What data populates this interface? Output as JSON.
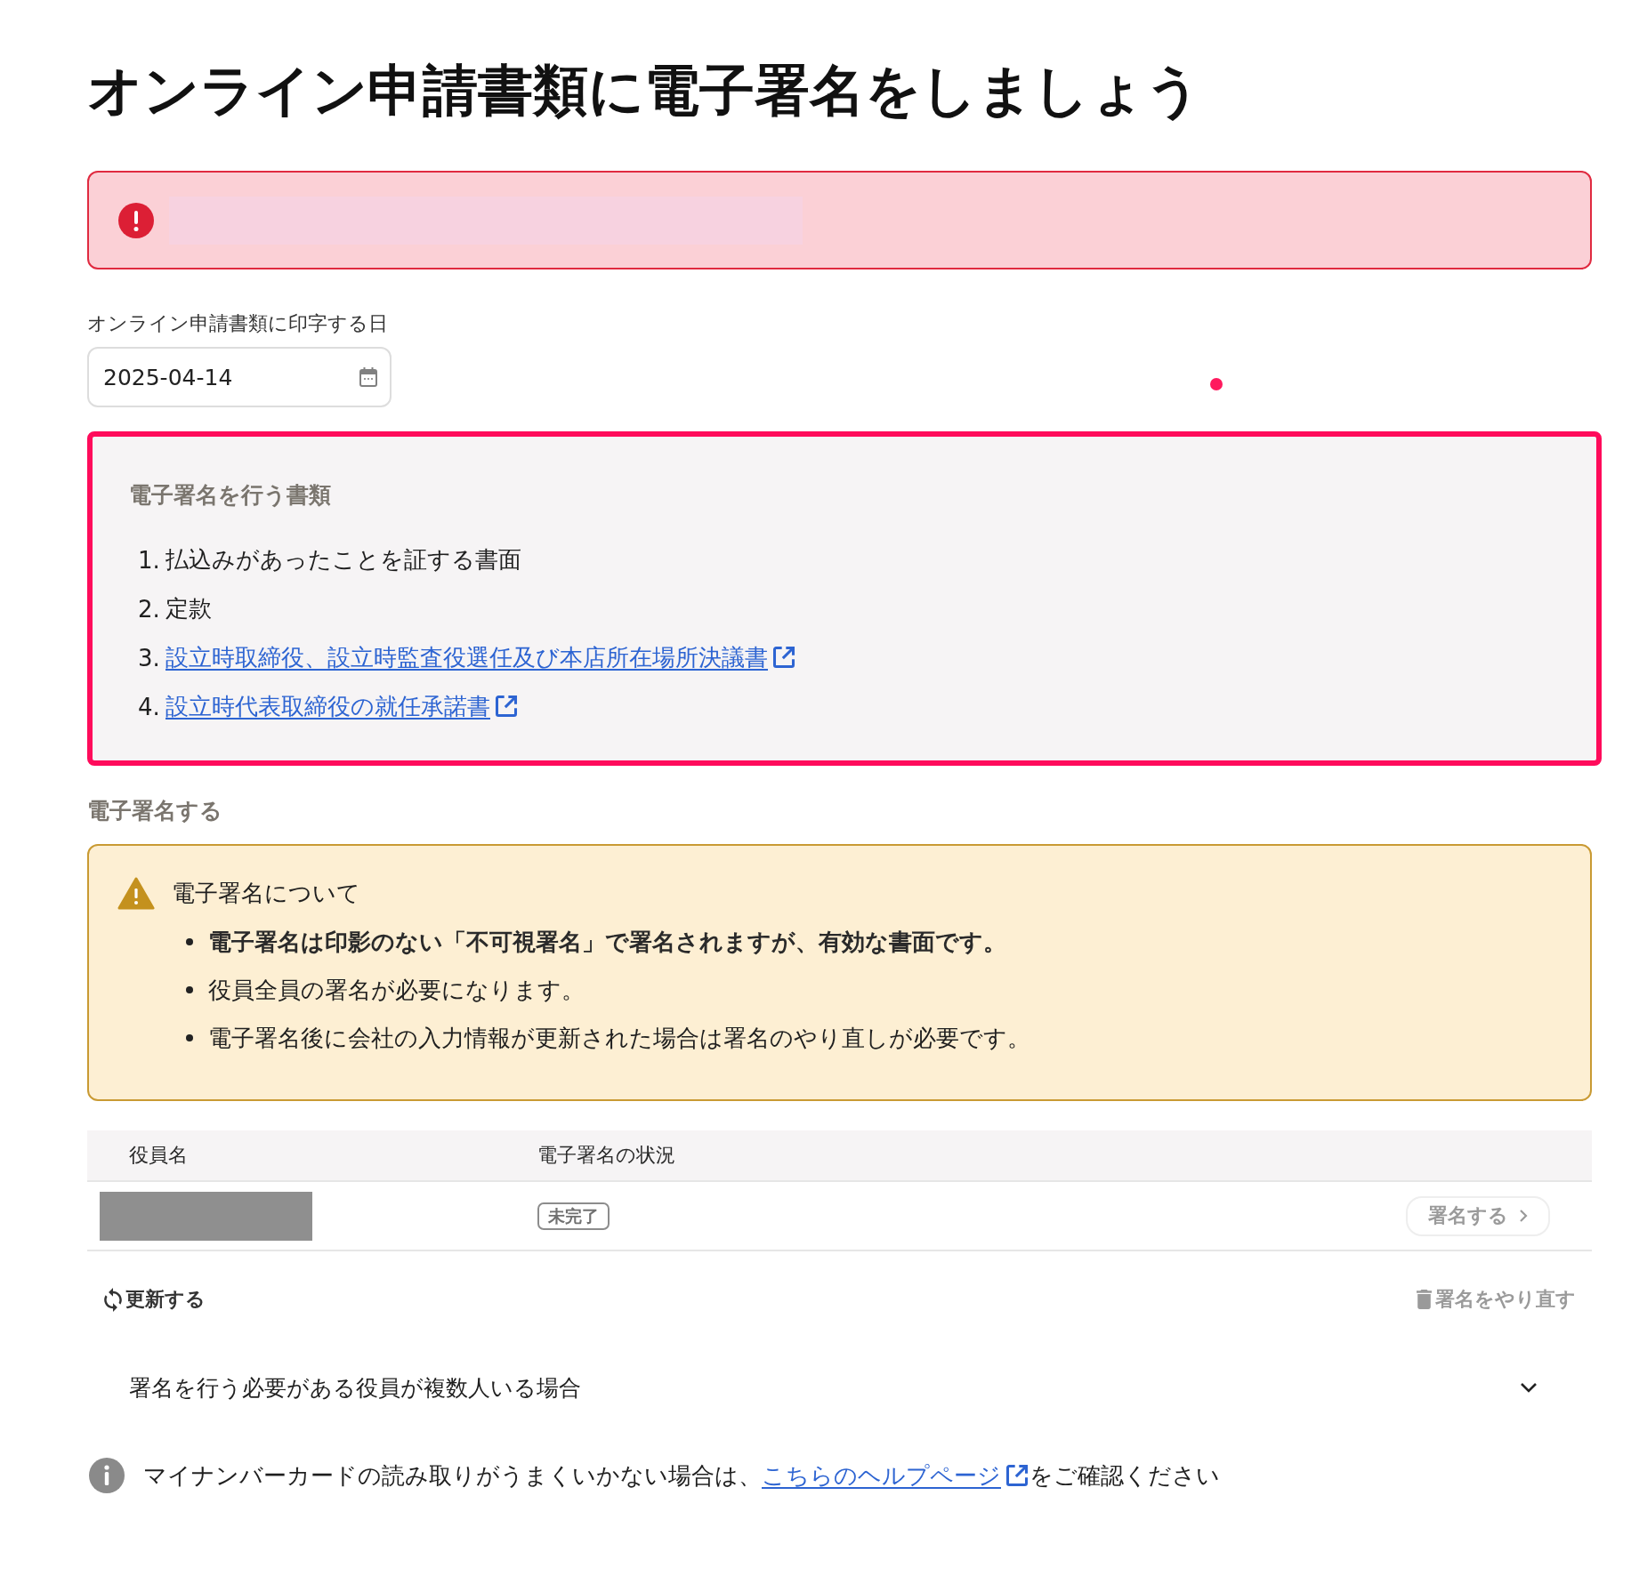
{
  "page": {
    "title": "オンライン申請書類に電子署名をしましょう"
  },
  "alert": {
    "kind": "error"
  },
  "print_date": {
    "label": "オンライン申請書類に印字する日",
    "value": "2025-04-14"
  },
  "documents": {
    "heading": "電子署名を行う書類",
    "items": [
      {
        "number": "1.",
        "text": "払込みがあったことを証する書面",
        "kind": "text"
      },
      {
        "number": "2.",
        "text": "定款",
        "kind": "text"
      },
      {
        "number": "3.",
        "text": "設立時取締役、設立時監査役選任及び本店所在場所決議書",
        "kind": "link"
      },
      {
        "number": "4.",
        "text": "設立時代表取締役の就任承諾書",
        "kind": "link"
      }
    ]
  },
  "signing": {
    "heading": "電子署名する",
    "notice": {
      "kind": "warning",
      "title": "電子署名について",
      "items": [
        {
          "text": "電子署名は印影のない「不可視署名」で署名されますが、有効な書面です。",
          "bold": true
        },
        {
          "text": "役員全員の署名が必要になります。",
          "bold": false
        },
        {
          "text": "電子署名後に会社の入力情報が更新された場合は署名のやり直しが必要です。",
          "bold": false
        }
      ]
    },
    "table": {
      "columns": [
        "役員名",
        "電子署名の状況"
      ],
      "rows": [
        {
          "status": "未完了",
          "action": {
            "label": "署名する",
            "disabled": true
          }
        }
      ]
    },
    "refresh": {
      "label": "更新する",
      "disabled": false
    },
    "redo": {
      "label": "署名をやり直す",
      "disabled": true
    }
  },
  "accordion": {
    "label": "署名を行う必要がある役員が複数人いる場合",
    "expanded": false
  },
  "help_note": {
    "before": "マイナンバーカードの読み取りがうまくいかない場合は、",
    "link": "こちらのヘルプページ",
    "after": "をご確認ください"
  }
}
